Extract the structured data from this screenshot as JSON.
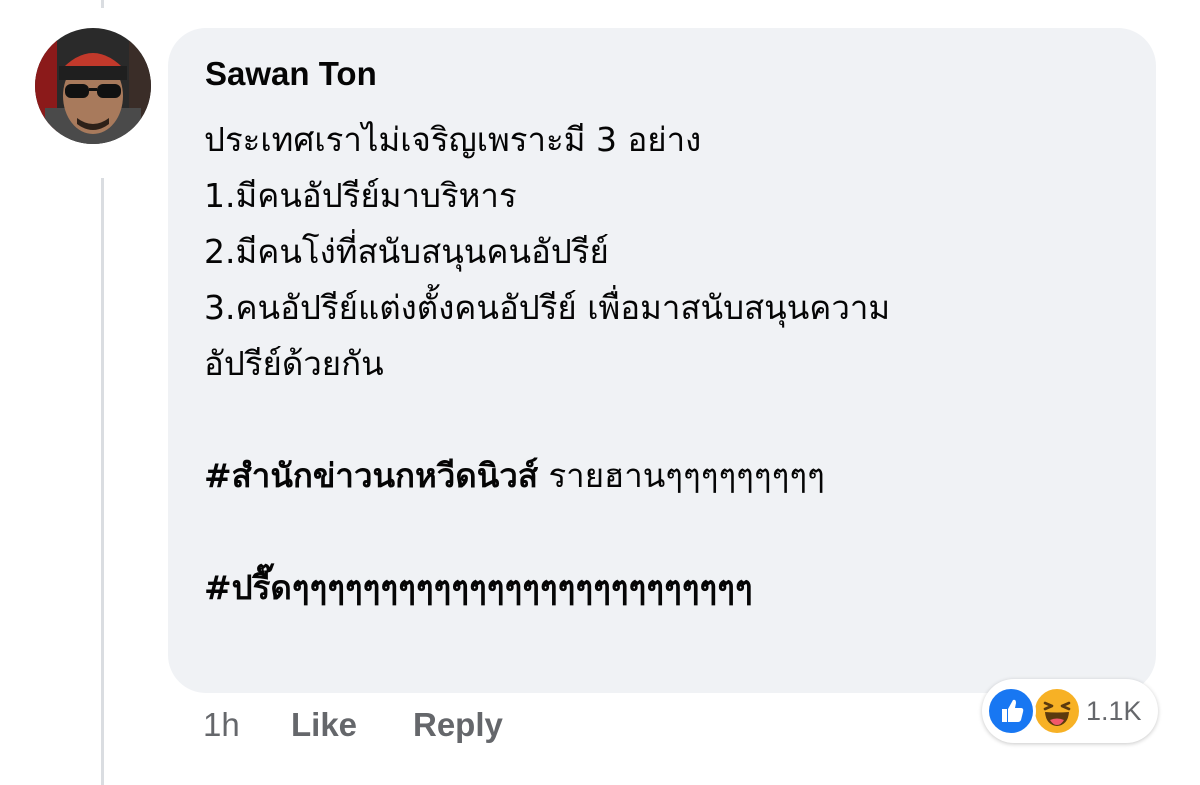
{
  "comment": {
    "author": "Sawan Ton",
    "lines": [
      "ประเทศเราไม่เจริญเพราะมี 3 อย่าง",
      "1.มีคนอัปรีย์มาบริหาร",
      "2.มีคนโง่ที่สนับสนุนคนอัปรีย์",
      "3.คนอัปรีย์แต่งตั้งคนอัปรีย์ เพื่อมาสนับสนุนความ",
      "อัปรีย์ด้วยกัน"
    ],
    "hashtag1": "#สำนักข่าวนกหวีดนิวส์",
    "hashtag1_suffix": " รายฮานๆๆๆๆๆๆๆๆๆ",
    "hashtag2": "#ปรื๊ดๆๆๆๆๆๆๆๆๆๆๆๆๆๆๆๆๆๆๆๆๆๆๆๆๆๆ"
  },
  "actions": {
    "time": "1h",
    "like_label": "Like",
    "reply_label": "Reply"
  },
  "reactions": {
    "count": "1.1K",
    "icons": [
      "like-icon",
      "haha-icon"
    ],
    "like_color": "#1877f2",
    "haha_color": "#f7b125"
  },
  "colors": {
    "bubble": "#f0f2f5",
    "text": "#050505",
    "secondary_text": "#65676b",
    "thread_line": "#dadde1"
  }
}
